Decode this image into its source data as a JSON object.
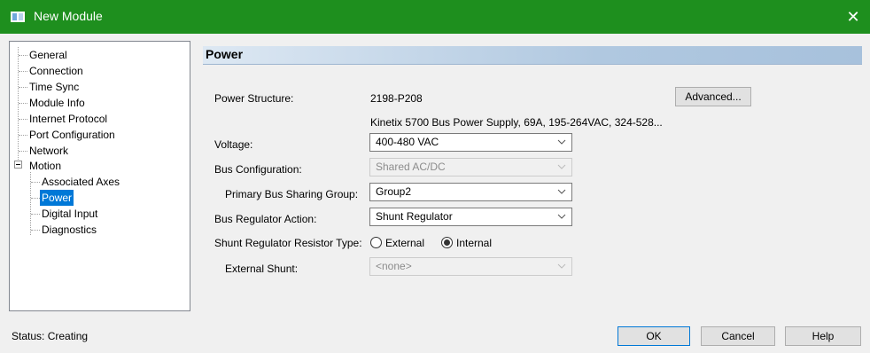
{
  "window": {
    "title": "New Module",
    "close_glyph": "✕"
  },
  "tree": {
    "items": [
      {
        "label": "General"
      },
      {
        "label": "Connection"
      },
      {
        "label": "Time Sync"
      },
      {
        "label": "Module Info"
      },
      {
        "label": "Internet Protocol"
      },
      {
        "label": "Port Configuration"
      },
      {
        "label": "Network"
      },
      {
        "label": "Motion"
      },
      {
        "label": "Associated Axes"
      },
      {
        "label": "Power",
        "selected": true
      },
      {
        "label": "Digital Input"
      },
      {
        "label": "Diagnostics"
      }
    ]
  },
  "section": {
    "title": "Power"
  },
  "form": {
    "power_structure_label": "Power Structure:",
    "power_structure_value": "2198-P208",
    "advanced_label": "Advanced...",
    "power_structure_desc": "Kinetix 5700 Bus Power Supply, 69A, 195-264VAC, 324-528...",
    "voltage_label": "Voltage:",
    "voltage_value": "400-480 VAC",
    "bus_config_label": "Bus Configuration:",
    "bus_config_value": "Shared AC/DC",
    "primary_bus_label": "Primary Bus Sharing Group:",
    "primary_bus_value": "Group2",
    "bus_reg_label": "Bus Regulator Action:",
    "bus_reg_value": "Shunt Regulator",
    "shunt_type_label": "Shunt Regulator Resistor Type:",
    "shunt_external_label": "External",
    "shunt_internal_label": "Internal",
    "shunt_selected": "Internal",
    "external_shunt_label": "External Shunt:",
    "external_shunt_value": "<none>"
  },
  "footer": {
    "status": "Status: Creating",
    "ok_label": "OK",
    "cancel_label": "Cancel",
    "help_label": "Help"
  },
  "colors": {
    "titlebar": "#1e8f1e",
    "selection": "#0078d7"
  }
}
